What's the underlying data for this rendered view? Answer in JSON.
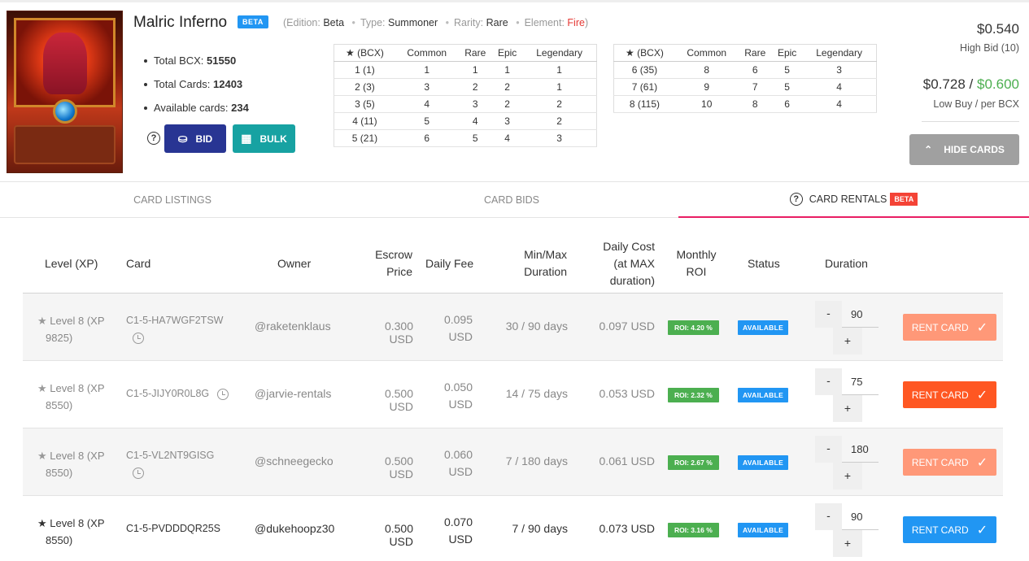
{
  "card": {
    "name": "Malric Inferno",
    "badge": "BETA",
    "meta": {
      "edition_label": "(Edition:",
      "edition": "Beta",
      "type_label": "Type:",
      "type": "Summoner",
      "rarity_label": "Rarity:",
      "rarity": "Rare",
      "element_label": "Element:",
      "element": "Fire",
      "close": ")"
    }
  },
  "stats": [
    {
      "label": "Total BCX:",
      "value": "51550"
    },
    {
      "label": "Total Cards:",
      "value": "12403"
    },
    {
      "label": "Available cards:",
      "value": "234"
    }
  ],
  "buttons": {
    "help": "?",
    "bid": "BID",
    "bulk": "BULK",
    "hide_cards": "HIDE CARDS"
  },
  "bcx_table": {
    "headers": [
      "(BCX)",
      "Common",
      "Rare",
      "Epic",
      "Legendary"
    ],
    "left": [
      [
        "1 (1)",
        "1",
        "1",
        "1",
        "1"
      ],
      [
        "2 (3)",
        "3",
        "2",
        "2",
        "1"
      ],
      [
        "3 (5)",
        "4",
        "3",
        "2",
        "2"
      ],
      [
        "4 (11)",
        "5",
        "4",
        "3",
        "2"
      ],
      [
        "5 (21)",
        "6",
        "5",
        "4",
        "3"
      ]
    ],
    "right": [
      [
        "6 (35)",
        "8",
        "6",
        "5",
        "3"
      ],
      [
        "7 (61)",
        "9",
        "7",
        "5",
        "4"
      ],
      [
        "8 (115)",
        "10",
        "8",
        "6",
        "4"
      ]
    ]
  },
  "prices": {
    "high_bid": "$0.540",
    "high_bid_label": "High Bid (10)",
    "low_buy": "$0.728",
    "slash": "/",
    "per_bcx": "$0.600",
    "low_buy_label": "Low Buy / per BCX"
  },
  "tabs": [
    {
      "label": "CARD LISTINGS"
    },
    {
      "label": "CARD BIDS"
    },
    {
      "label": "CARD RENTALS",
      "badge": "BETA"
    }
  ],
  "rentals": {
    "headers": {
      "level": "Level (XP)",
      "card": "Card",
      "owner": "Owner",
      "escrow_1": "Escrow",
      "escrow_2": "Price",
      "fee": "Daily Fee",
      "minmax_1": "Min/Max",
      "minmax_2": "Duration",
      "dcost_1": "Daily Cost",
      "dcost_2": "(at MAX",
      "dcost_3": "duration)",
      "roi_1": "Monthly",
      "roi_2": "ROI",
      "status": "Status",
      "duration": "Duration"
    },
    "rows": [
      {
        "level": "Level 8",
        "xp": "(XP",
        "xp_val": "9825)",
        "card": "C1-5-HA7WGF2TSW",
        "owner": "@raketenklaus",
        "escrow": "0.300 USD",
        "fee": "0.095",
        "fee_unit": "USD",
        "minmax": "30 / 90 days",
        "dcost": "0.097 USD",
        "roi": "ROI: 4.20 %",
        "status": "AVAILABLE",
        "duration": "90",
        "minus": "-",
        "plus": "+",
        "rent": "RENT CARD",
        "rent_color": "#ff9878"
      },
      {
        "level": "Level 8",
        "xp": "(XP",
        "xp_val": "8550)",
        "card": "C1-5-JIJY0R0L8G",
        "owner": "@jarvie-rentals",
        "escrow": "0.500 USD",
        "fee": "0.050",
        "fee_unit": "USD",
        "minmax": "14 / 75 days",
        "dcost": "0.053 USD",
        "roi": "ROI: 2.32 %",
        "status": "AVAILABLE",
        "duration": "75",
        "minus": "-",
        "plus": "+",
        "rent": "RENT CARD",
        "rent_color": "#ff5722"
      },
      {
        "level": "Level 8",
        "xp": "(XP",
        "xp_val": "8550)",
        "card": "C1-5-VL2NT9GISG",
        "owner": "@schneegecko",
        "escrow": "0.500 USD",
        "fee": "0.060",
        "fee_unit": "USD",
        "minmax": "7 / 180 days",
        "dcost": "0.061 USD",
        "roi": "ROI: 2.67 %",
        "status": "AVAILABLE",
        "duration": "180",
        "minus": "-",
        "plus": "+",
        "rent": "RENT CARD",
        "rent_color": "#ff9878"
      },
      {
        "level": "Level 8",
        "xp": "(XP",
        "xp_val": "8550)",
        "card": "C1-5-PVDDDQR25S",
        "owner": "@dukehoopz30",
        "escrow": "0.500 USD",
        "fee": "0.070",
        "fee_unit": "USD",
        "minmax": "7 / 90 days",
        "dcost": "0.073 USD",
        "roi": "ROI: 3.16 %",
        "status": "AVAILABLE",
        "duration": "90",
        "minus": "-",
        "plus": "+",
        "rent": "RENT CARD",
        "rent_color": "#2196f3"
      }
    ]
  },
  "icons": {
    "star": "star-icon",
    "alarm": "alarm-clock-icon",
    "check": "check-icon",
    "chevron": "chevron-up-icon"
  }
}
